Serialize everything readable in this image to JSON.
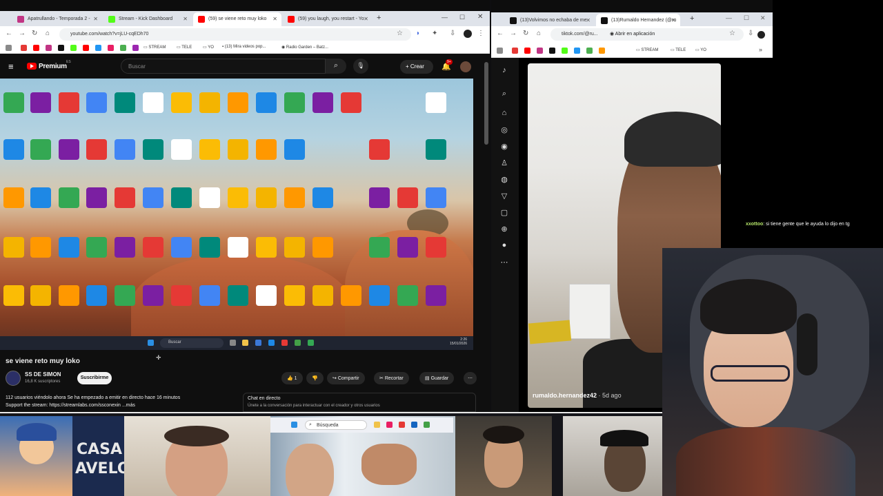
{
  "left_browser": {
    "tabs": [
      {
        "label": "Apatrullando - Temporada 2 -",
        "color": "#c13584"
      },
      {
        "label": "Stream - Kick Dashboard",
        "color": "#53fc18"
      },
      {
        "label": "(59) se viene reto muy loko",
        "color": "#ff0000"
      },
      {
        "label": "(59) you laugh, you restart - Yo",
        "color": "#ff0000"
      }
    ],
    "url": "youtube.com/watch?v=jLU-cqEDh70",
    "bookmarks": [
      "STREAM",
      "TELE",
      "YO",
      "(13) Mira videos pop...",
      "Radio Garden – Batz..."
    ]
  },
  "youtube": {
    "logo_label": "Premium",
    "logo_sup": "ES",
    "search_placeholder": "Buscar",
    "create_label": "Crear",
    "notif_count": "9+",
    "video_title": "se viene reto muy loko",
    "channel_name": "SS DE SIMON",
    "channel_subs": "16,8 K suscriptores",
    "subscribe_label": "Suscribirme",
    "likes": "1",
    "share_label": "Compartir",
    "clip_label": "Recortar",
    "save_label": "Guardar",
    "description_line1": "112 usuarios viéndolo ahora  Se ha empezado a emitir en directo hace 16 minutos",
    "description_line2": "Support the stream: https://streamlabs.com/ssconexin ...más",
    "chat_title": "Chat en directo",
    "chat_sub": "Únete a la conversación para interactuar con el creador y otros usuarios"
  },
  "desktop": {
    "taskbar_search": "Buscar",
    "clock": "2:26",
    "date": "15/01/2026"
  },
  "right_browser": {
    "tabs": [
      {
        "label": "(13)Volvimos no echaba de me",
        "color": "#111111"
      },
      {
        "label": "(13)Rumaldo Hernandez (@ru",
        "color": "#111111"
      }
    ],
    "url": "tiktok.com/@ru...",
    "open_in_app": "Abrir en aplicación",
    "bookmarks": [
      "STREAM",
      "TELE",
      "YO"
    ]
  },
  "tiktok": {
    "username": "rumaldo.hernandez42",
    "time_ago": "· 5d ago",
    "sidebar_icons": [
      "tiktok-logo-icon",
      "search-icon",
      "home-icon",
      "compass-icon",
      "profile-circle-icon",
      "following-icon",
      "live-icon",
      "explore-icon",
      "messages-icon",
      "upload-icon",
      "avatar-icon",
      "more-icon"
    ]
  },
  "stream_chat": {
    "user": "xxottoo",
    "message": ": si tiene gente que le ayuda lo dijo en tg"
  },
  "bottom_strip": {
    "casa_text": "CASA D",
    "avelo_text": "AVELO",
    "mini_search": "Búsqueda"
  }
}
